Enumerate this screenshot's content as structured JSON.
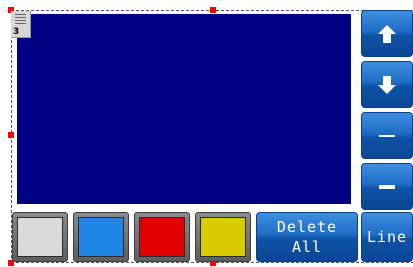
{
  "panel": {
    "tag_number": "3"
  },
  "side_buttons": [
    {
      "icon": "arrow-up-icon"
    },
    {
      "icon": "arrow-down-icon"
    },
    {
      "icon": "minus-thin-icon"
    },
    {
      "icon": "minus-thick-icon"
    }
  ],
  "colors": {
    "light_gray": "#d9d9d9",
    "blue": "#1e86e4",
    "red": "#e30000",
    "yellow": "#d6cc00",
    "canvas": "#000080"
  },
  "actions": {
    "delete_all_line1": "Delete",
    "delete_all_line2": "All",
    "line_label": "Line"
  }
}
